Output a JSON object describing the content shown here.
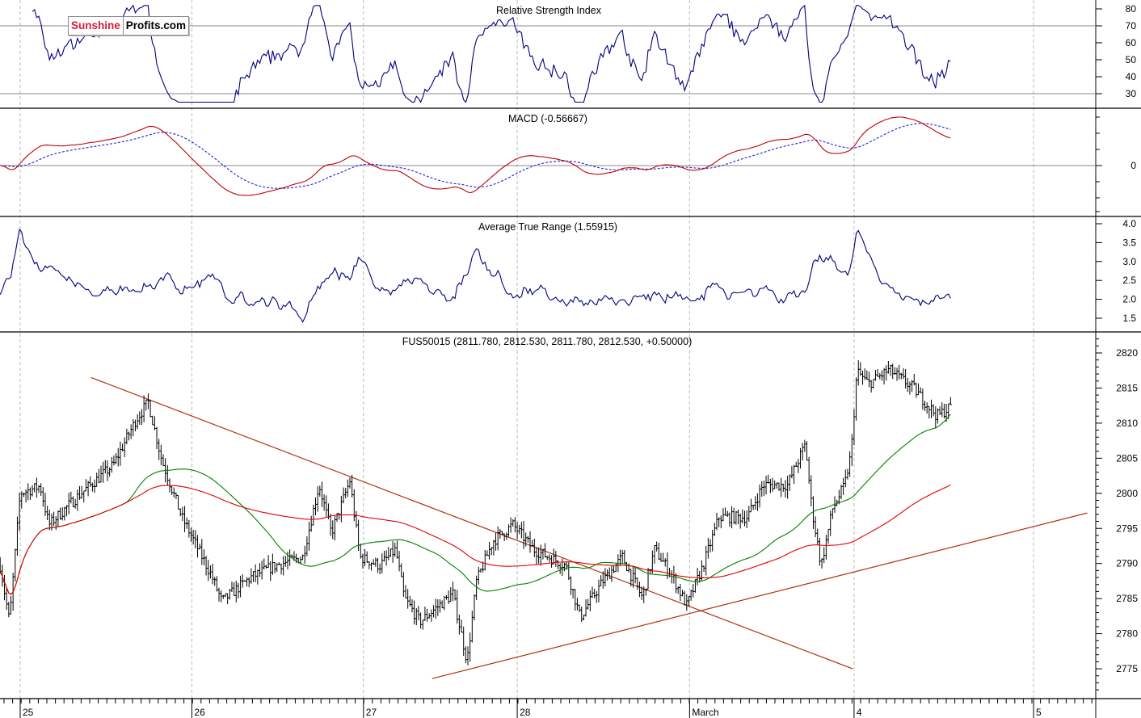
{
  "logo": {
    "part1": "Sunshine",
    "part2": "Profits.com"
  },
  "chart_data": [
    {
      "type": "line",
      "title": "Relative Strength Index",
      "yticks": [
        80,
        70,
        60,
        50,
        40,
        30
      ],
      "ylim": [
        25,
        85
      ],
      "reference_lines": [
        70,
        30
      ],
      "series": [
        {
          "name": "RSI",
          "color": "#000080",
          "period": 14
        }
      ]
    },
    {
      "type": "line",
      "title": "MACD (-0.56667)",
      "yticks": [
        0
      ],
      "reference_lines": [
        0
      ],
      "series": [
        {
          "name": "MACD",
          "color": "#c00000"
        },
        {
          "name": "Signal",
          "color": "#2020e0",
          "style": "dashed"
        }
      ]
    },
    {
      "type": "line",
      "title": "Average True Range (1.55915)",
      "yticks": [
        4.0,
        3.5,
        3.0,
        2.5,
        2.0,
        1.5
      ],
      "ylim": [
        1.25,
        4.2
      ],
      "series": [
        {
          "name": "ATR",
          "color": "#000080",
          "period": 14
        }
      ]
    },
    {
      "type": "bar",
      "subtype": "ohlc",
      "title": "FUS50015 (2811.780, 2812.530, 2811.780, 2812.530, +0.50000)",
      "ylim": [
        2771,
        2822
      ],
      "yticks": [
        2820,
        2815,
        2810,
        2805,
        2800,
        2795,
        2790,
        2785,
        2780,
        2775
      ],
      "x_unit": "hours since start of Feb 25 session",
      "x_ticks": [
        {
          "label": "25",
          "t": 0
        },
        {
          "label": "26",
          "t": 24
        },
        {
          "label": "27",
          "t": 48
        },
        {
          "label": "28",
          "t": 69.5
        },
        {
          "label": "March",
          "t": 93.6
        },
        {
          "label": "4",
          "t": 116.6
        },
        {
          "label": "5",
          "t": 141.7
        }
      ],
      "close_keypoints": [
        [
          -2.8,
          2789.7
        ],
        [
          -1.5,
          2781.7
        ],
        [
          0,
          2800
        ],
        [
          2.8,
          2801
        ],
        [
          4,
          2795.5
        ],
        [
          8.5,
          2800
        ],
        [
          13,
          2804
        ],
        [
          16.2,
          2810.5
        ],
        [
          17.9,
          2813
        ],
        [
          19.8,
          2804.7
        ],
        [
          22.6,
          2796.6
        ],
        [
          26.6,
          2788.6
        ],
        [
          28.2,
          2784.6
        ],
        [
          32.2,
          2788
        ],
        [
          35.6,
          2789.7
        ],
        [
          39.5,
          2790.9
        ],
        [
          41.8,
          2801.2
        ],
        [
          43.5,
          2794.3
        ],
        [
          46.1,
          2801.8
        ],
        [
          47.5,
          2790.9
        ],
        [
          50.3,
          2789.7
        ],
        [
          52.5,
          2792
        ],
        [
          53.7,
          2785.1
        ],
        [
          55.9,
          2781.7
        ],
        [
          60.5,
          2785.7
        ],
        [
          62.5,
          2776
        ],
        [
          63.8,
          2787.4
        ],
        [
          66.1,
          2793.2
        ],
        [
          68.9,
          2795.5
        ],
        [
          71.8,
          2792
        ],
        [
          76.3,
          2789.7
        ],
        [
          78.3,
          2782.3
        ],
        [
          81.4,
          2787.4
        ],
        [
          84.2,
          2790.9
        ],
        [
          87,
          2785.1
        ],
        [
          88.7,
          2792
        ],
        [
          91,
          2788.6
        ],
        [
          93.2,
          2784
        ],
        [
          95.5,
          2789.7
        ],
        [
          97.7,
          2796.6
        ],
        [
          101.7,
          2796.6
        ],
        [
          103.9,
          2801.2
        ],
        [
          107.3,
          2801.2
        ],
        [
          109.8,
          2807
        ],
        [
          110.7,
          2797.8
        ],
        [
          112,
          2789.7
        ],
        [
          113.6,
          2797.8
        ],
        [
          115.3,
          2801.2
        ],
        [
          116.2,
          2805.8
        ],
        [
          117,
          2817.4
        ],
        [
          118.6,
          2815.6
        ],
        [
          121.5,
          2817.6
        ],
        [
          124.9,
          2815
        ],
        [
          128.2,
          2811
        ],
        [
          130.3,
          2812.5
        ]
      ],
      "moving_averages": [
        {
          "name": "MA short",
          "color": "#008000",
          "period": 20
        },
        {
          "name": "MA long",
          "color": "#e00000",
          "period": 50
        }
      ],
      "trendlines": [
        {
          "name": "resistance",
          "color": "#b03010",
          "from": [
            9.9,
            2816.5
          ],
          "to": [
            116.4,
            2775
          ]
        },
        {
          "name": "support",
          "color": "#b03010",
          "from": [
            57.6,
            2773.6
          ],
          "to": [
            149.2,
            2797.2
          ]
        }
      ],
      "last": {
        "open": 2811.78,
        "high": 2812.53,
        "low": 2811.78,
        "close": 2812.53,
        "change": 0.5
      }
    }
  ]
}
